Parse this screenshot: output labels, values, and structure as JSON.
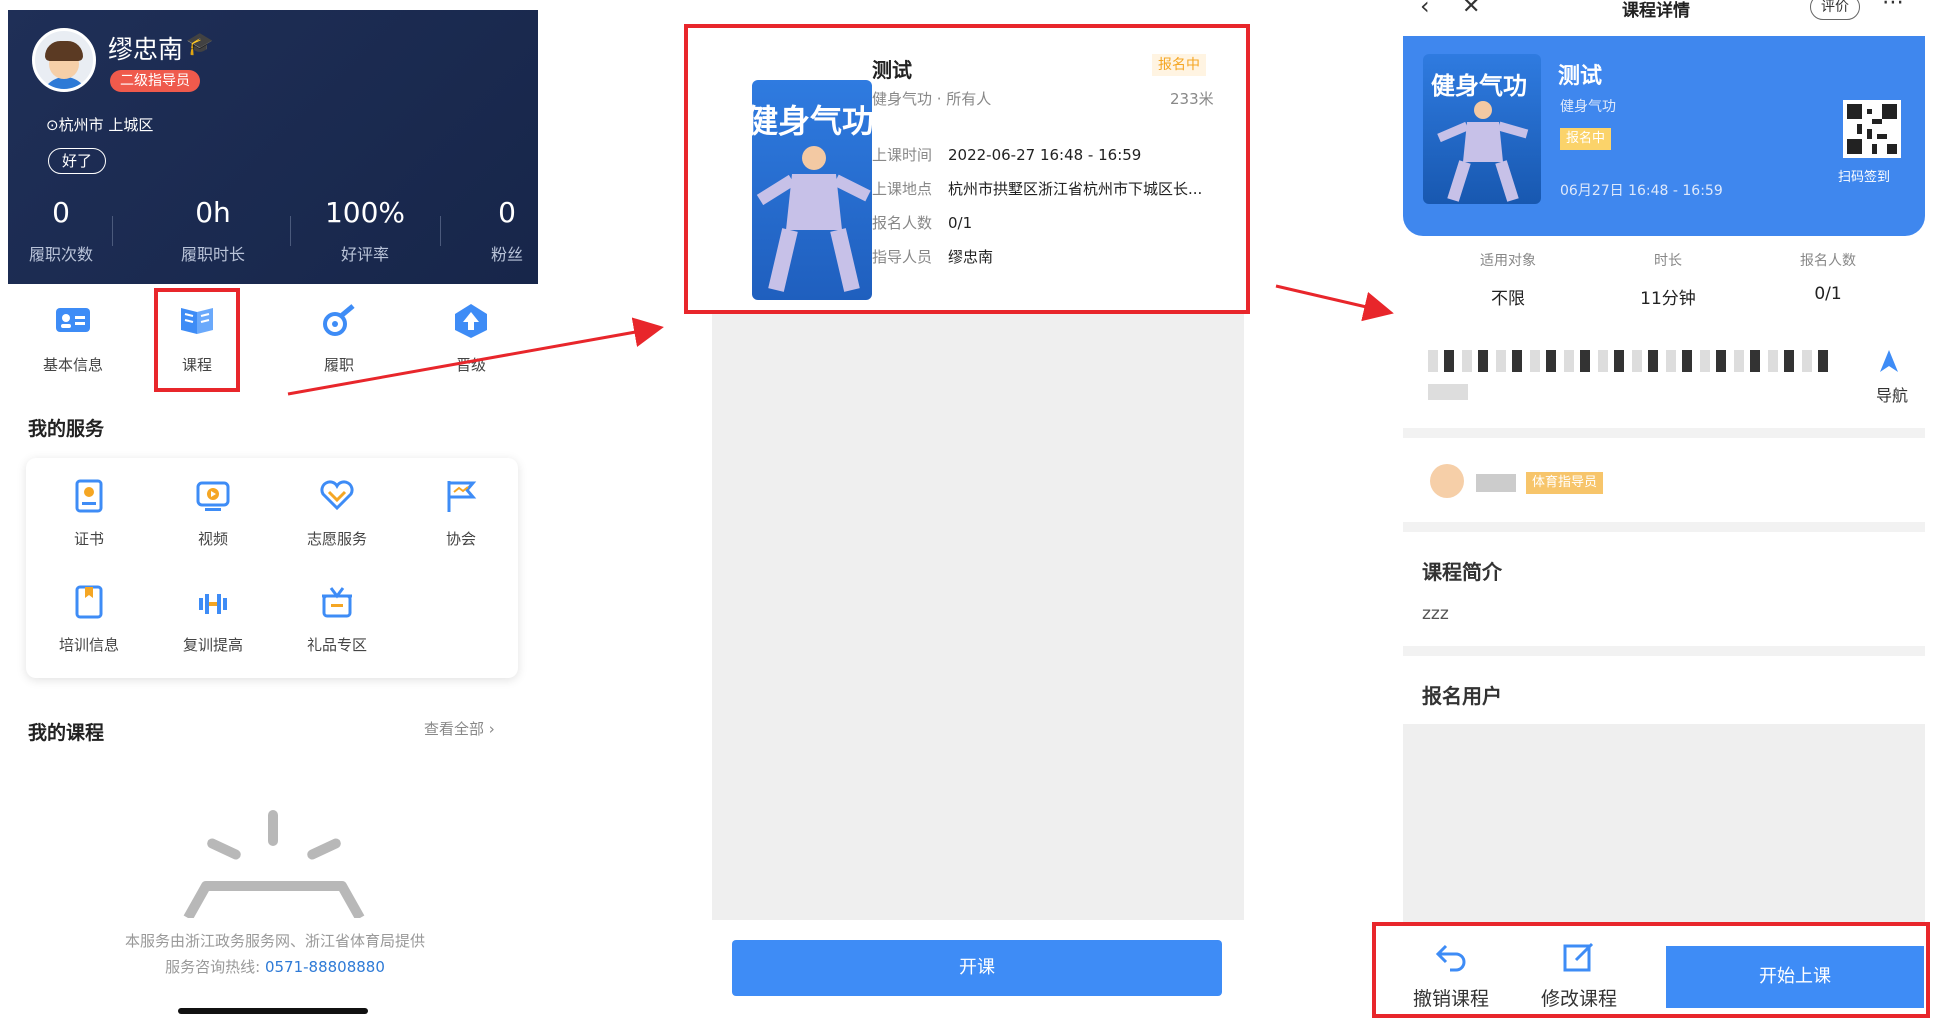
{
  "panel1": {
    "name": "缪忠南",
    "level_badge": "二级指导员",
    "location": "杭州市 上城区",
    "ok_label": "好了",
    "stats": [
      {
        "value": "0",
        "label": "履职次数"
      },
      {
        "value": "0h",
        "label": "履职时长"
      },
      {
        "value": "100%",
        "label": "好评率"
      },
      {
        "value": "0",
        "label": "粉丝"
      }
    ],
    "quick": [
      {
        "label": "基本信息",
        "icon": "id-card-icon"
      },
      {
        "label": "课程",
        "icon": "book-icon"
      },
      {
        "label": "履职",
        "icon": "whistle-icon"
      },
      {
        "label": "晋级",
        "icon": "upgrade-icon"
      }
    ],
    "services_title": "我的服务",
    "services": [
      {
        "label": "证书",
        "icon": "certificate-icon"
      },
      {
        "label": "视频",
        "icon": "video-icon"
      },
      {
        "label": "志愿服务",
        "icon": "heart-hands-icon"
      },
      {
        "label": "协会",
        "icon": "flag-icon"
      },
      {
        "label": "培训信息",
        "icon": "bookmark-icon"
      },
      {
        "label": "复训提高",
        "icon": "dumbbell-icon"
      },
      {
        "label": "礼品专区",
        "icon": "gift-icon"
      }
    ],
    "courses_title": "我的课程",
    "see_all": "查看全部 ›",
    "footer_line1": "本服务由浙江政务服务网、浙江省体育局提供",
    "footer_line2_prefix": "服务咨询热线:",
    "hotline": "0571-88808880"
  },
  "panel2": {
    "image_text": "健身气功",
    "title": "测试",
    "status": "报名中",
    "subtitle": "健身气功 · 所有人",
    "distance": "233米",
    "rows": [
      {
        "key": "上课时间",
        "value": "2022-06-27 16:48 - 16:59"
      },
      {
        "key": "上课地点",
        "value": "杭州市拱墅区浙江省杭州市下城区长..."
      },
      {
        "key": "报名人数",
        "value": "0/1"
      },
      {
        "key": "指导人员",
        "value": "缪忠南"
      }
    ],
    "button": "开课"
  },
  "panel3": {
    "header_title": "课程详情",
    "header_pill": "评价",
    "image_text": "健身气功",
    "title": "测试",
    "subtitle": "健身气功",
    "status": "报名中",
    "time": "06月27日 16:48 - 16:59",
    "qr_label": "扫码签到",
    "info": [
      {
        "key": "适用对象",
        "value": "不限"
      },
      {
        "key": "时长",
        "value": "11分钟"
      },
      {
        "key": "报名人数",
        "value": "0/1"
      }
    ],
    "nav_label": "导航",
    "coach_tag": "体育指导员",
    "intro_title": "课程简介",
    "intro_text": "zzz",
    "users_title": "报名用户",
    "actions": [
      {
        "label": "撤销课程",
        "icon": "undo-icon"
      },
      {
        "label": "修改课程",
        "icon": "edit-icon"
      }
    ],
    "start_button": "开始上课"
  },
  "colors": {
    "accent": "#3e8cf6",
    "highlight": "#e8262b",
    "header_bg": "#1f2f57"
  }
}
